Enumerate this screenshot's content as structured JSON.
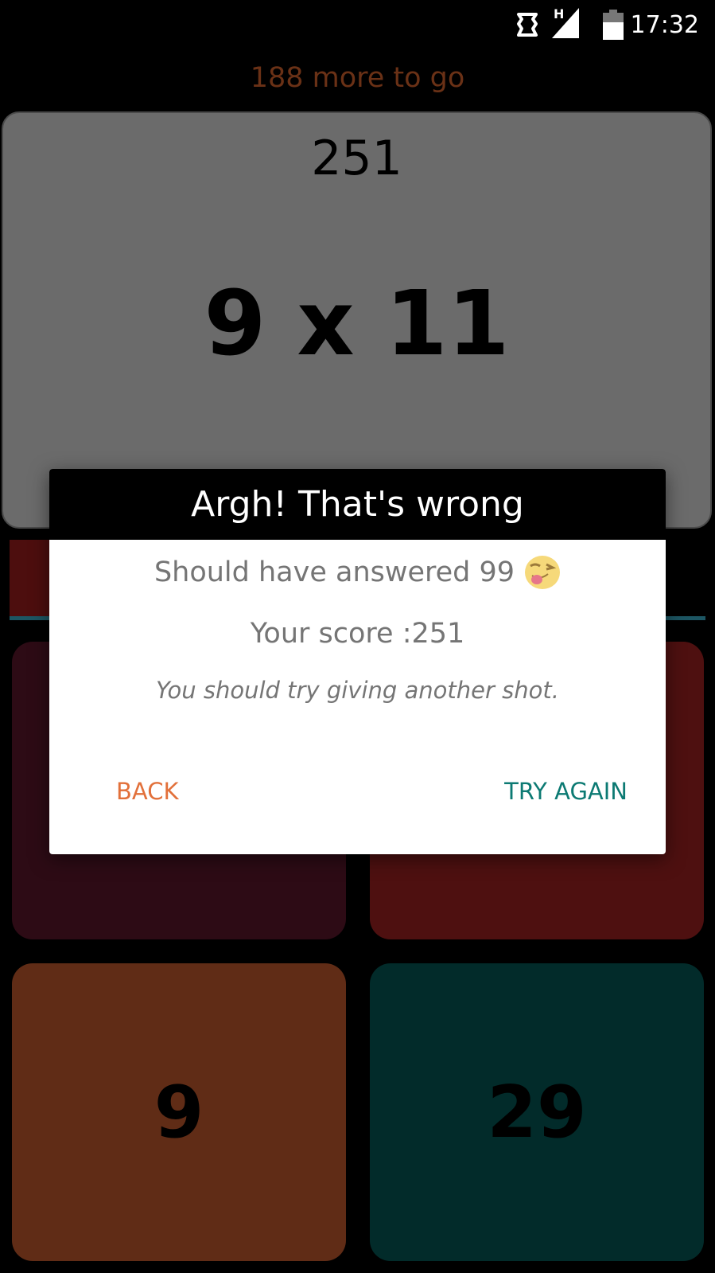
{
  "status_bar": {
    "network_type": "H",
    "time": "17:32",
    "icons": [
      "vibrate-icon",
      "signal-icon",
      "battery-icon"
    ]
  },
  "game": {
    "remaining": "188 more to go",
    "score": "251",
    "question": "9 x 11"
  },
  "answers": [
    {
      "label": ""
    },
    {
      "label": ""
    },
    {
      "label": "9"
    },
    {
      "label": "29"
    }
  ],
  "dialog": {
    "title": "Argh! That's wrong",
    "answer_text": "Should have answered 99",
    "emoji": "winking-tongue-emoji",
    "score_text": "Your score :251",
    "hint": "You should try giving another shot.",
    "back_label": "BACK",
    "retry_label": "TRY AGAIN"
  },
  "colors": {
    "accent_orange": "#e2703a",
    "accent_teal": "#0c7a73",
    "tile_a": "#2d0b15",
    "tile_b": "#4e1010",
    "tile_c": "#602c16",
    "tile_d": "#022b2a"
  }
}
